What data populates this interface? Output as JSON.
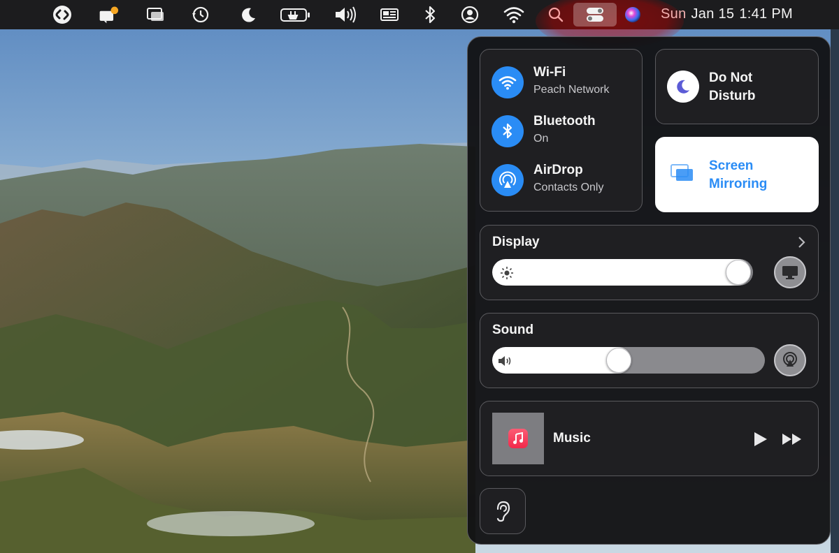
{
  "menubar": {
    "icons": [
      "shazam-icon",
      "notifications-icon",
      "display-windows-icon",
      "time-machine-icon",
      "moon-icon",
      "battery-icon",
      "volume-icon",
      "keyboard-input-icon",
      "bluetooth-icon",
      "user-icon",
      "wifi-icon",
      "spotlight-search-icon",
      "control-center-icon",
      "siri-icon"
    ],
    "clock": {
      "day": "Sun",
      "date": "Jan 15",
      "time": "1:41 PM"
    }
  },
  "control_center": {
    "wifi": {
      "title": "Wi-Fi",
      "subtitle": "Peach Network"
    },
    "bluetooth": {
      "title": "Bluetooth",
      "subtitle": "On"
    },
    "airdrop": {
      "title": "AirDrop",
      "subtitle": "Contacts Only"
    },
    "do_not_disturb": {
      "label_line1": "Do Not",
      "label_line2": "Disturb"
    },
    "screen_mirroring": {
      "label_line1": "Screen",
      "label_line2": "Mirroring"
    },
    "display": {
      "title": "Display",
      "brightness": 0.99
    },
    "sound": {
      "title": "Sound",
      "volume": 0.46
    },
    "now_playing": {
      "title": "Music"
    }
  },
  "colors": {
    "accent": "#2a8cf5",
    "menubar_bg": "#1c1c1e",
    "panel_bg": "#121214",
    "highlight": "#c00000",
    "music_icon": "#f2294b"
  }
}
